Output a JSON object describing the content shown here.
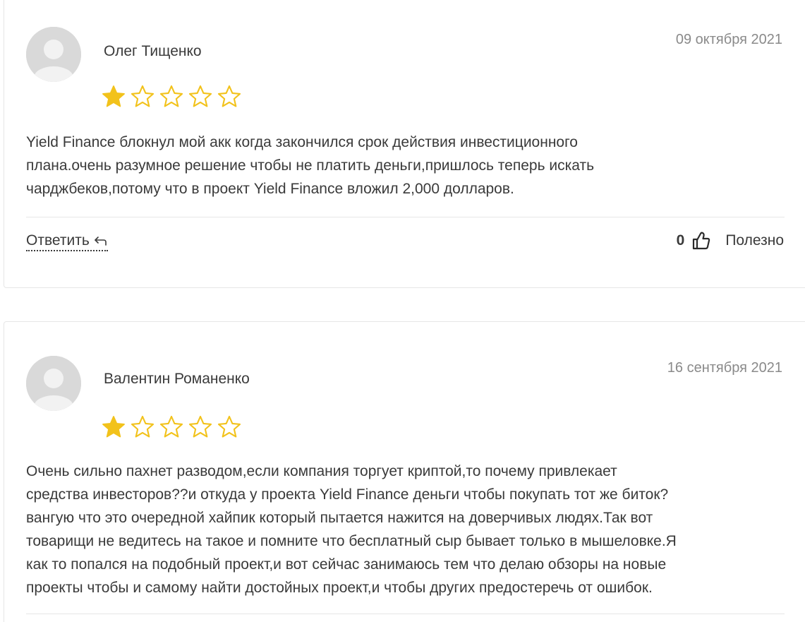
{
  "reviews": [
    {
      "author": "Олег Тищенко",
      "date": "09 октября 2021",
      "rating": 1,
      "rating_max": 5,
      "text_lines": [
        "Yield Finance блокнул мой акк когда закончился срок действия инвестиционного",
        "плана.очень разумное решение чтобы не платить деньги,пришлось теперь искать",
        "чарджбеков,потому что в проект Yield Finance вложил 2,000 долларов."
      ],
      "reply_label": "Ответить",
      "helpful_count": "0",
      "helpful_label": "Полезно"
    },
    {
      "author": "Валентин Романенко",
      "date": "16 сентября 2021",
      "rating": 1,
      "rating_max": 5,
      "text_lines": [
        "Очень сильно пахнет разводом,если компания торгует криптой,то почему привлекает",
        "средства инвесторов??и откуда у проекта Yield Finance деньги чтобы покупать тот же биток?",
        "вангую что это очередной хайпик который пытается нажится на доверчивых людях.Так вот",
        "товарищи не ведитесь на такое и помните что бесплатный сыр бывает только в мышеловке.Я",
        "как то попался на подобный проект,и вот сейчас занимаюсь тем что делаю обзоры на новые",
        "проекты чтобы и самому найти достойных проект,и чтобы других предостеречь от ошибок."
      ]
    }
  ],
  "colors": {
    "star_filled": "#f2c21b",
    "star_outline": "#f2c21b",
    "avatar_bg": "#d9d9d9",
    "avatar_fg": "#f2f2f2",
    "text": "#3a3a3a",
    "date": "#8a8a8a",
    "divider": "#e6e6e6"
  },
  "icons": {
    "avatar": "user-silhouette-icon",
    "star": "star-icon",
    "reply": "reply-arrow-icon",
    "like": "thumbs-up-icon"
  }
}
